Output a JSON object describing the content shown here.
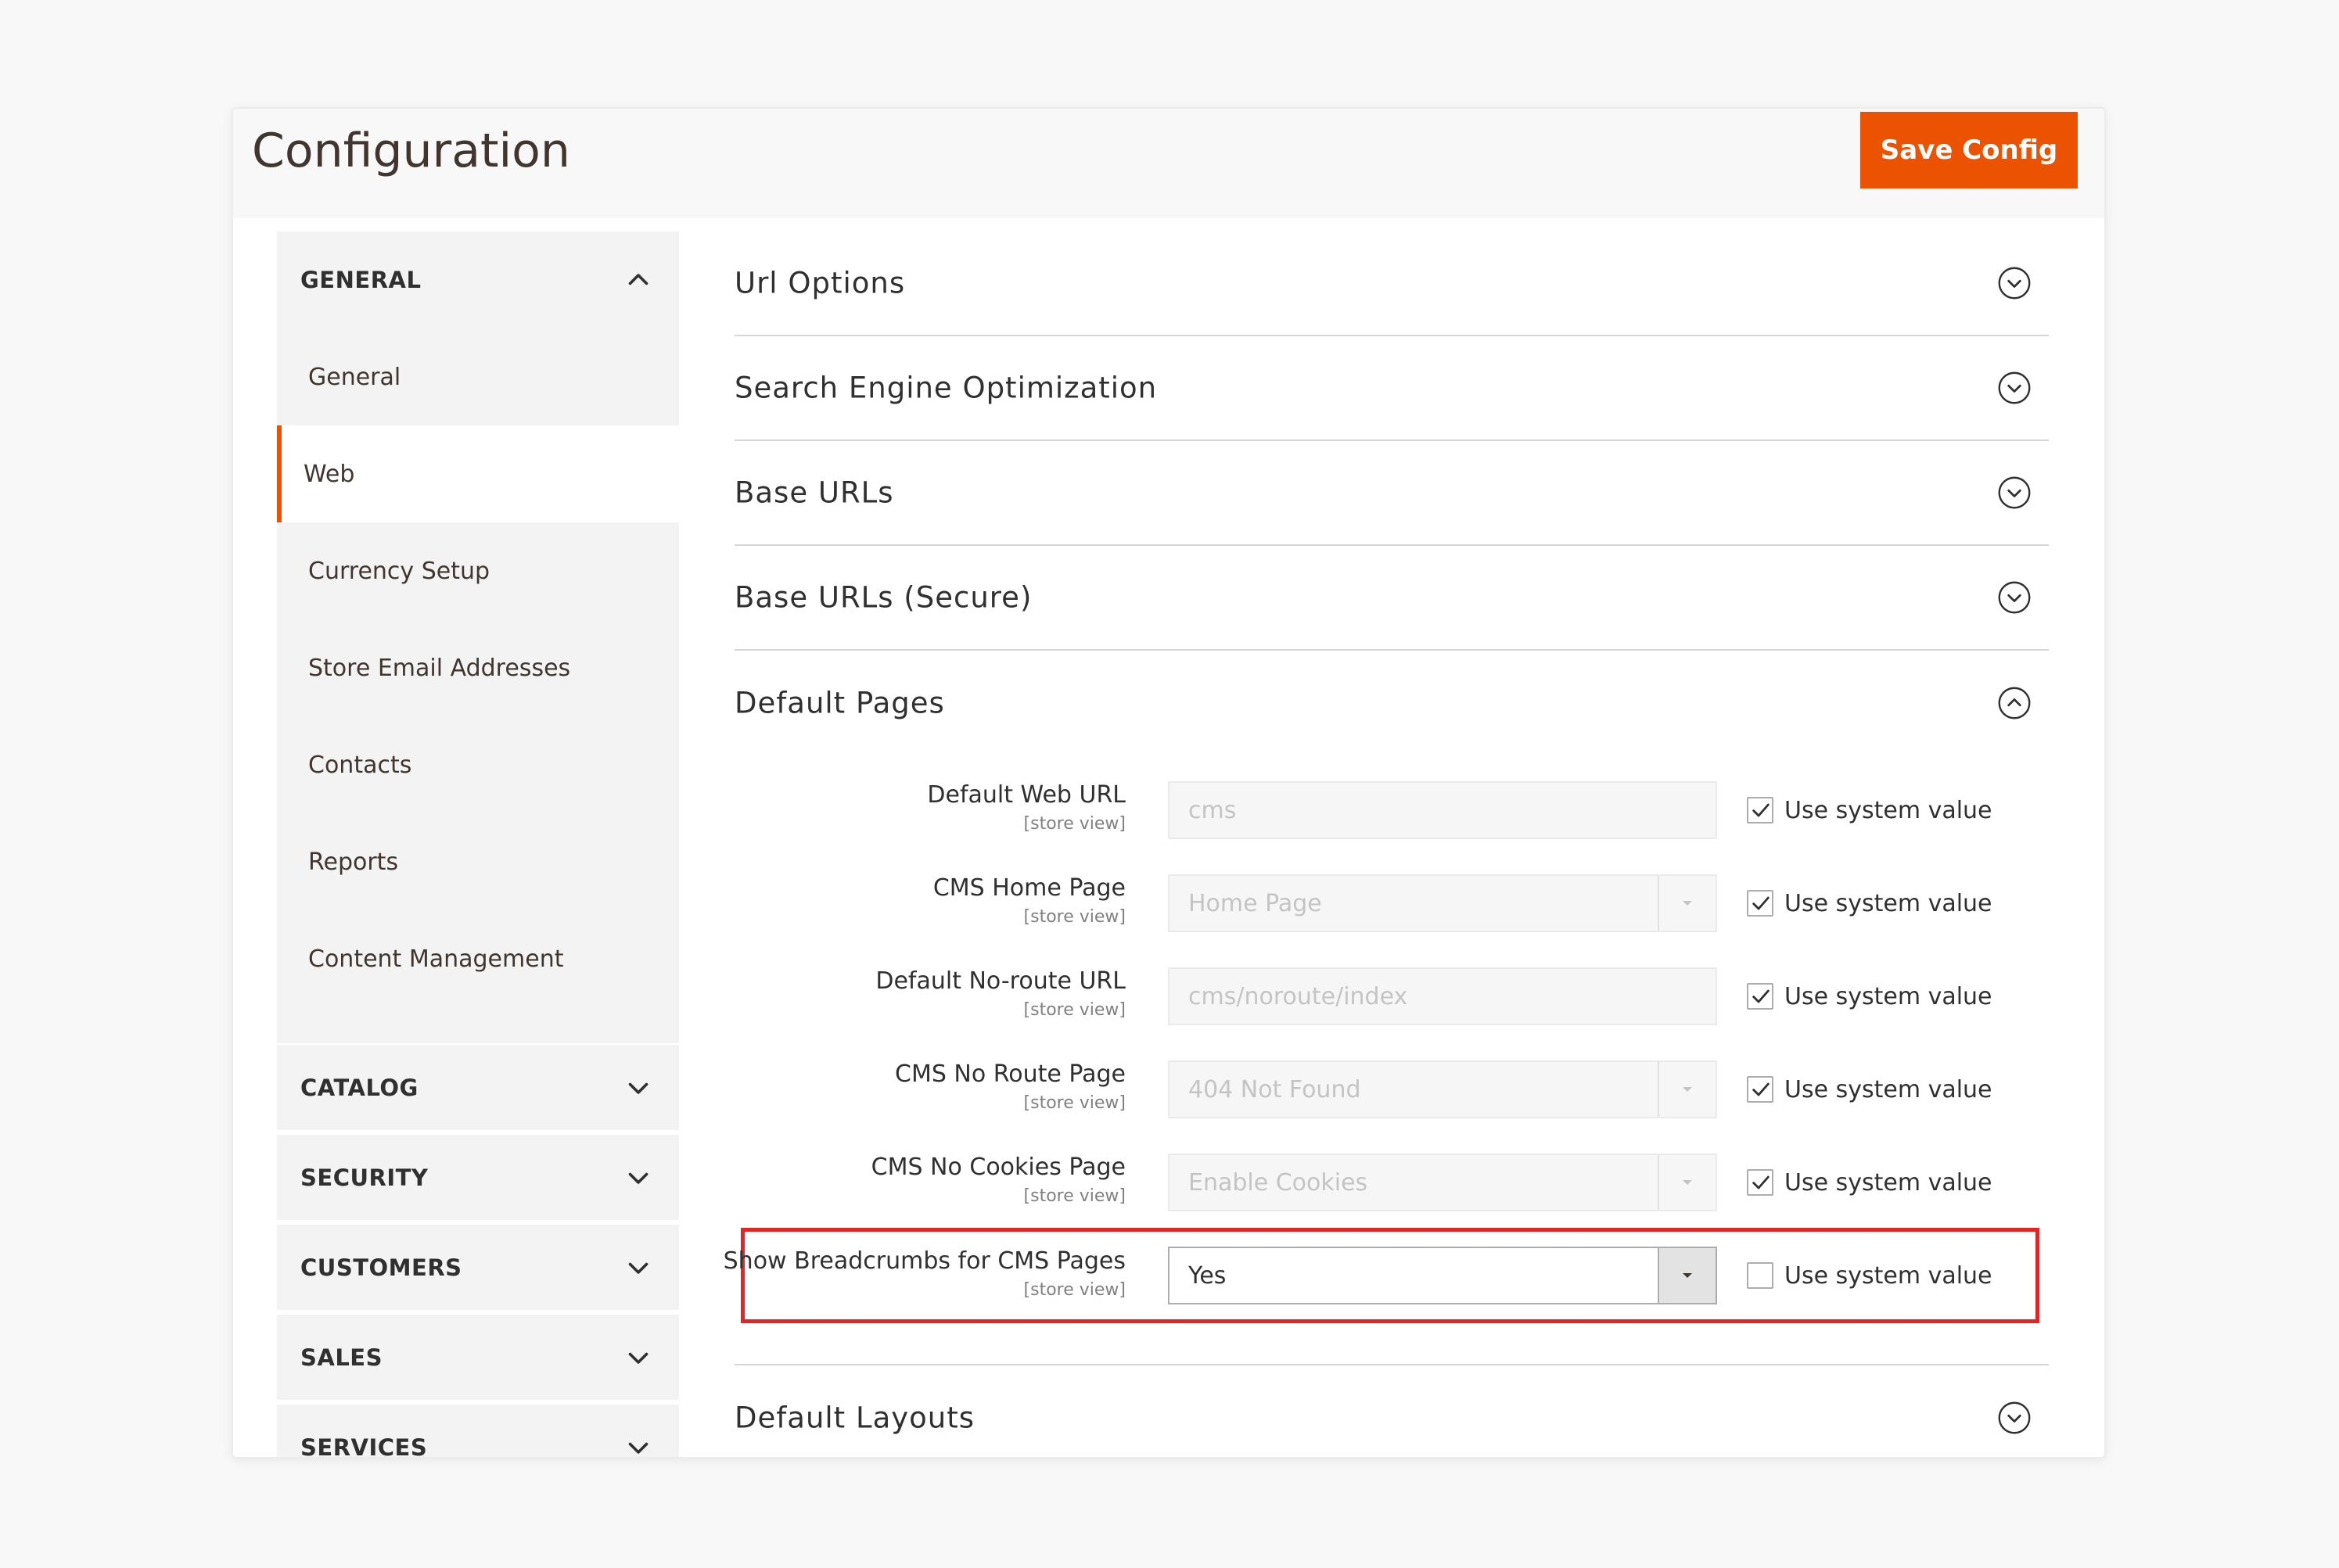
{
  "header": {
    "title": "Configuration",
    "save_label": "Save Config"
  },
  "sidebar": {
    "general": {
      "label": "GENERAL",
      "items": [
        "General",
        "Web",
        "Currency Setup",
        "Store Email Addresses",
        "Contacts",
        "Reports",
        "Content Management"
      ],
      "active": "Web"
    },
    "groups": [
      "CATALOG",
      "SECURITY",
      "CUSTOMERS",
      "SALES",
      "SERVICES"
    ]
  },
  "sections": {
    "url_options": "Url Options",
    "seo": "Search Engine Optimization",
    "base_urls": "Base URLs",
    "base_urls_secure": "Base URLs (Secure)",
    "default_pages": "Default Pages",
    "default_layouts": "Default Layouts"
  },
  "fields": {
    "scope": "[store view]",
    "use_system": "Use system value",
    "rows": [
      {
        "label": "Default Web URL",
        "value": "cms",
        "type": "text",
        "use_system": true
      },
      {
        "label": "CMS Home Page",
        "value": "Home Page",
        "type": "select",
        "use_system": true
      },
      {
        "label": "Default No-route URL",
        "value": "cms/noroute/index",
        "type": "text",
        "use_system": true
      },
      {
        "label": "CMS No Route Page",
        "value": "404 Not Found",
        "type": "select",
        "use_system": true
      },
      {
        "label": "CMS No Cookies Page",
        "value": "Enable Cookies",
        "type": "select",
        "use_system": true
      },
      {
        "label": "Show Breadcrumbs for CMS Pages",
        "value": "Yes",
        "type": "select",
        "use_system": false
      }
    ]
  },
  "colors": {
    "accent": "#eb5202",
    "highlight": "#e22626"
  },
  "icons": {
    "chevron_up": "chevron-up-icon",
    "chevron_down": "chevron-down-icon",
    "circle_down": "circle-chevron-down-icon",
    "circle_up": "circle-chevron-up-icon",
    "check": "check-icon",
    "dropdown": "dropdown-arrow-icon"
  }
}
